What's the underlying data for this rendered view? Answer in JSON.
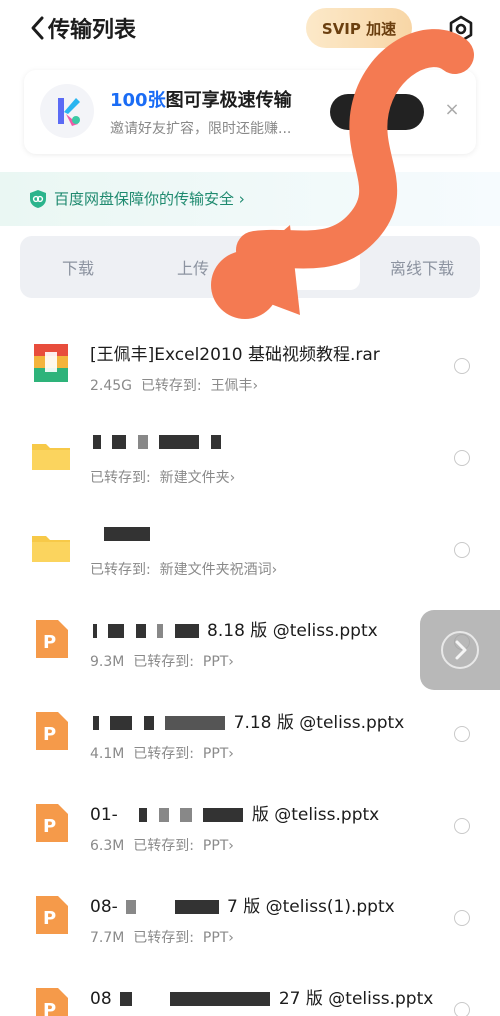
{
  "header": {
    "title": "传输列表",
    "svip_label": "SVIP 加速"
  },
  "promo": {
    "title_highlight": "100张",
    "title_rest": "图可享极速传输",
    "subtitle": "邀请好友扩容，限时还能赚...",
    "close_glyph": "×"
  },
  "security": {
    "text": "百度网盘保障你的传输安全",
    "chevron": "›"
  },
  "tabs": [
    {
      "label": "下载"
    },
    {
      "label": "上传"
    },
    {
      "label": ""
    },
    {
      "label": "离线下载"
    }
  ],
  "files": [
    {
      "name": "[王佩丰]Excel2010 基础视频教程.rar",
      "size": "2.45G",
      "dest_prefix": "已转存到:",
      "dest": "王佩丰›",
      "icon": "archive-icon"
    },
    {
      "name": "",
      "size": "",
      "dest_prefix": "已转存到:",
      "dest": "新建文件夹›",
      "icon": "folder-icon"
    },
    {
      "name": "",
      "size": "",
      "dest_prefix": "已转存到:",
      "dest": "新建文件夹祝酒词›",
      "icon": "folder-icon"
    },
    {
      "name": "8.18 版 @teliss.pptx",
      "size": "9.3M",
      "dest_prefix": "已转存到:",
      "dest": "PPT›",
      "icon": "ppt-icon"
    },
    {
      "name": "7.18 版 @teliss.pptx",
      "size": "4.1M",
      "dest_prefix": "已转存到:",
      "dest": "PPT›",
      "icon": "ppt-icon"
    },
    {
      "name": "01-",
      "name_tail": "版 @teliss.pptx",
      "size": "6.3M",
      "dest_prefix": "已转存到:",
      "dest": "PPT›",
      "icon": "ppt-icon"
    },
    {
      "name": "08-",
      "name_tail": "7 版 @teliss(1).pptx",
      "size": "7.7M",
      "dest_prefix": "已转存到:",
      "dest": "PPT›",
      "icon": "ppt-icon"
    },
    {
      "name": "08",
      "name_tail": "27 版 @teliss.pptx",
      "size": "",
      "dest_prefix": "",
      "dest": "",
      "icon": "ppt-icon"
    }
  ],
  "colors": {
    "accent": "#1a6cf5",
    "security_green": "#1f8a6f",
    "ppt_orange": "#f59a4a",
    "folder_yellow": "#f7c948",
    "scribble": "#f47a52"
  }
}
